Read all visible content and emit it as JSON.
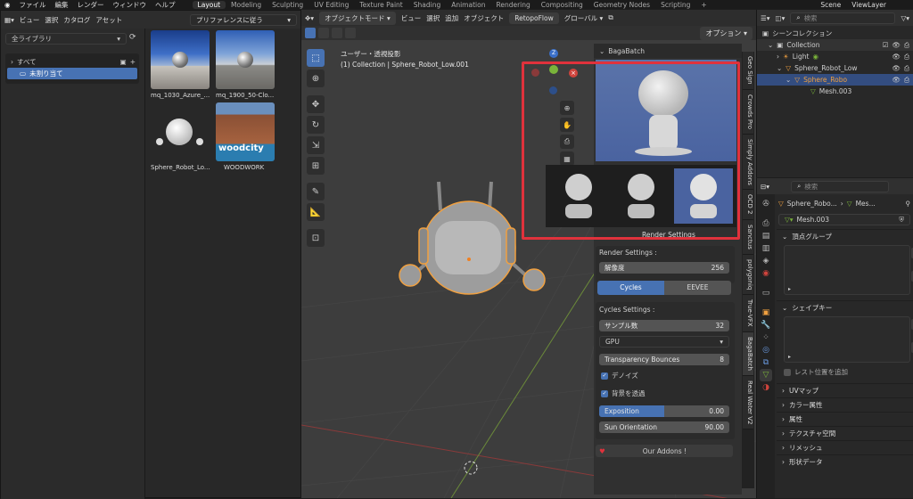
{
  "topbar": {
    "menus": [
      "ファイル",
      "編集",
      "レンダー",
      "ウィンドウ",
      "ヘルプ"
    ],
    "workspaces": [
      "Layout",
      "Modeling",
      "Sculpting",
      "UV Editing",
      "Texture Paint",
      "Shading",
      "Animation",
      "Rendering",
      "Compositing",
      "Geometry Nodes",
      "Scripting"
    ],
    "scene": "Scene",
    "view_layer": "ViewLayer"
  },
  "asset_browser": {
    "menus": [
      "ビュー",
      "選択",
      "カタログ",
      "アセット"
    ],
    "import_mode": "プリファレンスに従う",
    "library": "全ライブラリ",
    "tree": [
      "すべて",
      "未割り当て"
    ],
    "assets": [
      {
        "name": "mq_1030_Azure_..."
      },
      {
        "name": "mq_1900_50-Clo..."
      },
      {
        "name": "Sphere_Robot_Lo..."
      },
      {
        "name": "WOODWORK"
      }
    ],
    "woodcity_text": "woodcity"
  },
  "viewport": {
    "mode": "オブジェクトモード",
    "menus": [
      "ビュー",
      "選択",
      "追加",
      "オブジェクト"
    ],
    "addon": "RetopoFlow",
    "orientation": "グローバル",
    "options": "オプション",
    "view_name": "ユーザー・透視投影",
    "collection_info": "(1) Collection | Sphere_Robot_Low.001",
    "gizmo_z": "Z"
  },
  "sidebar_tabs": [
    "Geo Sign",
    "Crowds Pro",
    "Simply Addons",
    "OCD 2",
    "Sanctus",
    "polygoniq",
    "True-VFX",
    "BagaBatch",
    "Real Water V2"
  ],
  "bagabatch": {
    "title": "BagaBatch",
    "render_settings_label": "Render Settings",
    "render_settings_header": "Render Settings :",
    "resolution_label": "解像度",
    "resolution_value": "256",
    "engines": [
      "Cycles",
      "EEVEE"
    ],
    "active_engine": "Cycles",
    "cycles_header": "Cycles Settings :",
    "samples_label": "サンプル数",
    "samples_value": "32",
    "device": "GPU",
    "transparency_label": "Transparency Bounces",
    "transparency_value": "8",
    "denoise": "デノイズ",
    "transparent_bg": "背景を透過",
    "exposition_label": "Exposition",
    "exposition_value": "0.00",
    "exposition_fill": 0.5,
    "sun_label": "Sun Orientation",
    "sun_value": "90.00",
    "addons_button": "Our Addons !",
    "highlight_color": "#e0323c"
  },
  "outliner": {
    "search_placeholder": "検索",
    "items": [
      "シーンコレクション",
      "Collection",
      "Light",
      "Sphere_Robot_Low",
      "Sphere_Robo",
      "Mesh.003"
    ]
  },
  "properties": {
    "search_placeholder": "検索",
    "breadcrumb_object": "Sphere_Robo...",
    "breadcrumb_mesh": "Mes...",
    "mesh_name": "Mesh.003",
    "panels": [
      "頂点グループ",
      "シェイプキー",
      "UVマップ",
      "カラー属性",
      "属性",
      "テクスチャ空間",
      "リメッシュ",
      "形状データ"
    ],
    "shape_option": "レスト位置を追加"
  }
}
